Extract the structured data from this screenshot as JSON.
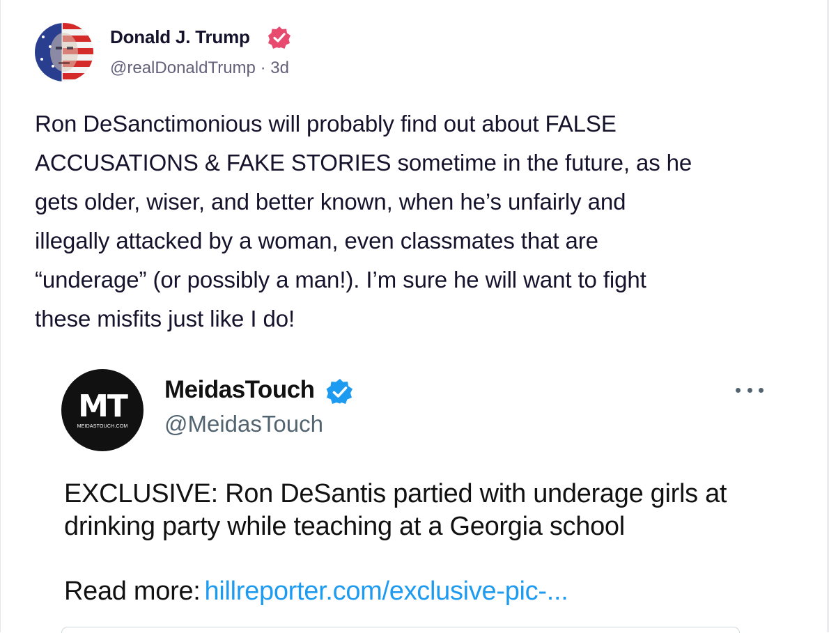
{
  "post": {
    "author_name": "Donald J. Trump",
    "handle": "@realDonaldTrump",
    "separator": "·",
    "time": "3d",
    "text": "Ron DeSanctimonious will probably find out about FALSE\nACCUSATIONS & FAKE STORIES sometime in the future, as he\ngets older, wiser, and better known, when he’s unfairly and\nillegally attacked by a woman, even classmates that are\n“underage” (or possibly a man!). I’m sure he will want to fight\nthese misfits just like I do!",
    "avatar_icon": "portrait-flag-avatar",
    "verified_icon": "verified-badge-icon",
    "verified_color": "#e8496f"
  },
  "quote": {
    "avatar_letters": "MT",
    "avatar_subtext": "MEIDASTOUCH.COM",
    "name": "MeidasTouch",
    "handle": "@MeidasTouch",
    "verified_color": "#1d9bf0",
    "more_icon": "more-options-icon",
    "text": "EXCLUSIVE: Ron DeSantis partied with underage girls at drinking party while teaching at a Georgia school",
    "read_more_label": "Read more:",
    "read_more_link": "hillreporter.com/exclusive-pic-..."
  }
}
